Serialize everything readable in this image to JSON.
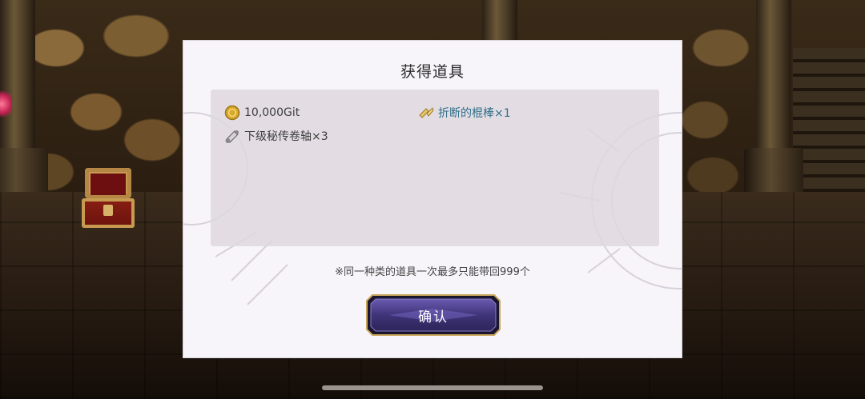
{
  "dialog": {
    "title": "获得道具",
    "items": [
      {
        "icon": "gold-coin-icon",
        "label": "10,000Git",
        "rare": false
      },
      {
        "icon": "broken-stick-icon",
        "label": "折断的棍棒×1",
        "rare": true
      },
      {
        "icon": "scroll-icon",
        "label": "下级秘传卷轴×3",
        "rare": false
      }
    ],
    "note": "※同一种类的道具一次最多只能带回999个",
    "confirm_label": "确认"
  },
  "colors": {
    "rare_item_text": "#2f6e8a",
    "button_fill": "#4b3f8c",
    "button_border": "#c9a55a"
  }
}
